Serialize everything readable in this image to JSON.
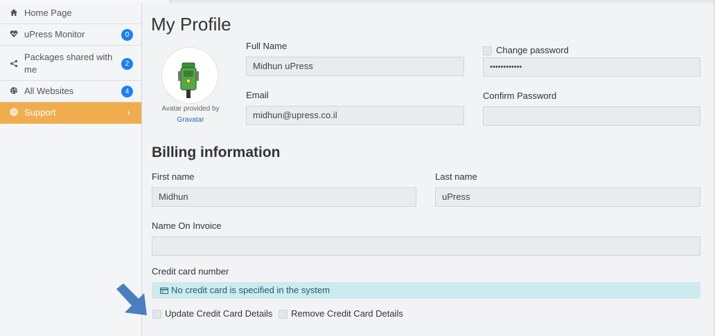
{
  "sidebar": {
    "items": [
      {
        "icon": "home-icon",
        "label": "Home Page"
      },
      {
        "icon": "heart-pulse-icon",
        "label": "uPress Monitor",
        "badge": "0"
      },
      {
        "icon": "share-icon",
        "label": "Packages shared with me",
        "badge": "2"
      },
      {
        "icon": "globe-icon",
        "label": "All Websites",
        "badge": "4"
      },
      {
        "icon": "lifebuoy-icon",
        "label": "Support",
        "active": true
      }
    ]
  },
  "profile": {
    "title": "My Profile",
    "avatar_caption": "Avatar provided by",
    "avatar_link": "Gravatar",
    "full_name_label": "Full Name",
    "full_name_value": "Midhun uPress",
    "email_label": "Email",
    "email_value": "midhun@upress.co.il",
    "change_password_label": "Change password",
    "password_value": "••••••••••••",
    "confirm_password_label": "Confirm Password",
    "confirm_password_value": ""
  },
  "billing": {
    "title": "Billing information",
    "first_name_label": "First name",
    "first_name_value": "Midhun",
    "last_name_label": "Last name",
    "last_name_value": "uPress",
    "invoice_label": "Name On Invoice",
    "invoice_value": "",
    "cc_label": "Credit card number",
    "cc_alert": "No credit card is specified in the system",
    "update_label": "Update Credit Card Details",
    "remove_label": "Remove Credit Card Details"
  },
  "colors": {
    "accent": "#f0ad4e",
    "badge": "#1e7ff0",
    "alert_bg": "#cdeaef",
    "arrow": "#4a7fbf"
  }
}
